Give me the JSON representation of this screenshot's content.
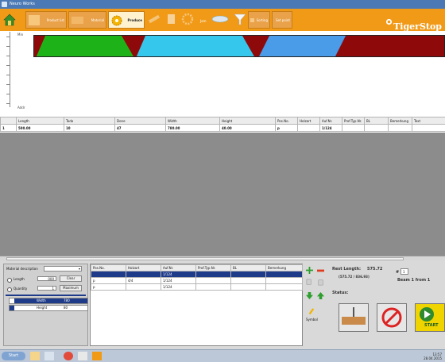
{
  "window": {
    "title": "Neuro Works"
  },
  "toolbar": {
    "buttons": [
      {
        "label": "Product list",
        "icon": "product-list-icon"
      },
      {
        "label": "Material",
        "icon": "material-icon"
      },
      {
        "label": "Produce",
        "icon": "produce-icon"
      },
      {
        "label": "",
        "icon": "measure-icon"
      },
      {
        "label": "",
        "icon": "document-icon"
      },
      {
        "label": "",
        "icon": "gear-icon"
      },
      {
        "label": "Jam",
        "icon": "saw-icon"
      },
      {
        "label": "",
        "icon": "funnel-icon"
      },
      {
        "label": "Sorting",
        "icon": "sort-icon"
      },
      {
        "label": "Set point",
        "icon": "setpoint-icon"
      }
    ],
    "brand": "TigerStop"
  },
  "ruler": {
    "top_label": "Min",
    "bottom_label": "Addr"
  },
  "cut_bar": {
    "pieces": [
      {
        "color": "#1db318"
      },
      {
        "color": "#35c8ec"
      },
      {
        "color": "#4a9be8"
      }
    ],
    "waste_color": "#8e0a0a"
  },
  "grid": {
    "columns": [
      "",
      "Length",
      "Todo",
      "Done",
      "Width",
      "Height",
      "Pos.No.",
      "Holzart",
      "Auf.Nr.",
      "Prof.Typ.Nr.",
      "BL",
      "Bemerkung",
      "Text"
    ],
    "rows": [
      [
        "1",
        "500.00",
        "10",
        "47",
        "780.00",
        "40.00",
        "p",
        "",
        "1/124",
        "",
        "",
        "",
        ""
      ]
    ]
  },
  "settings": {
    "material_description_label": "Material description",
    "length_label": "Length",
    "length_value": "000",
    "clear_button": "Clear",
    "quantity_label": "Quantity",
    "quantity_value": "1",
    "maximum_button": "Maximum",
    "dimensions": [
      {
        "name": "Width",
        "value": "780"
      },
      {
        "name": "Height",
        "value": "80"
      }
    ]
  },
  "list": {
    "columns": [
      "Pos.No.",
      "Holzart",
      "Auf.Nr.",
      "Prof.Typ.Nr.",
      "BL",
      "Bemerkung"
    ],
    "rows": [
      [
        "",
        "",
        "1/124",
        "",
        "",
        ""
      ],
      [
        "p",
        "4/4",
        "1/124",
        "",
        "",
        ""
      ],
      [
        "p",
        "",
        "1/124",
        "",
        "",
        ""
      ]
    ]
  },
  "side_icons": {
    "symbol_label": "Symbol"
  },
  "status": {
    "rest_length_label": "Rest Length:",
    "rest_length_value": "575.72",
    "rest_length_detail": "(575.72 / 836.93)",
    "piece_hash": "#",
    "piece_number": "1",
    "beam_text": "Beam 1 from 1",
    "status_label": "Status:",
    "start_label": "START"
  },
  "taskbar": {
    "start_label": "Start",
    "time": "13:57",
    "date": "28.04.2015"
  }
}
